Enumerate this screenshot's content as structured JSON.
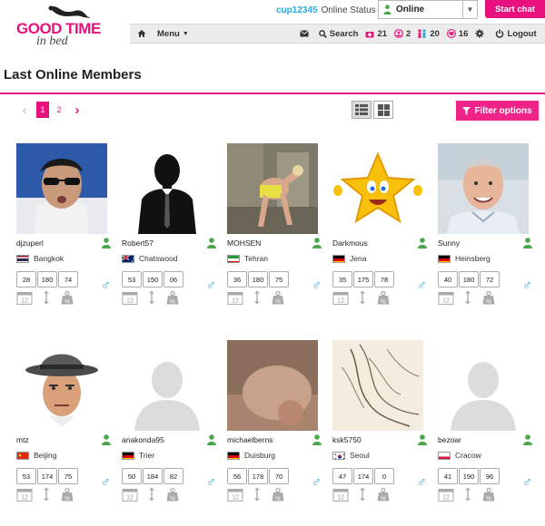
{
  "header": {
    "logo_top": "GOOD TIME",
    "logo_bottom": "in bed",
    "username": "cup12345",
    "status_label": "Online Status",
    "status_value": "Online",
    "start_chat": "Start chat"
  },
  "nav": {
    "menu": "Menu",
    "search": "Search",
    "photos_count": "21",
    "visitors_count": "2",
    "friends_count": "20",
    "favs_count": "16",
    "logout": "Logout"
  },
  "page": {
    "title": "Last Online Members",
    "pages": [
      "1",
      "2"
    ],
    "active_page": "1",
    "filter_label": "Filter options"
  },
  "colors": {
    "accent": "#e8117d",
    "online": "#49a84a",
    "male": "#2aa8d8"
  },
  "members": [
    {
      "name": "djzuperl",
      "city": "Bangkok",
      "flag": "th",
      "age": "28",
      "height": "180",
      "weight": "74",
      "photo": "sunglasses"
    },
    {
      "name": "Robert57",
      "city": "Chatswood",
      "flag": "au",
      "age": "53",
      "height": "150",
      "weight": "06",
      "photo": "silhouette"
    },
    {
      "name": "MOHSEN",
      "city": "Tehran",
      "flag": "ir",
      "age": "36",
      "height": "180",
      "weight": "75",
      "photo": "photo"
    },
    {
      "name": "Darkmous",
      "city": "Jena",
      "flag": "de",
      "age": "35",
      "height": "175",
      "weight": "78",
      "photo": "star"
    },
    {
      "name": "Sunny",
      "city": "Heinsberg",
      "flag": "de",
      "age": "40",
      "height": "180",
      "weight": "72",
      "photo": "man"
    },
    {
      "name": "mtz",
      "city": "Beijing",
      "flag": "cn",
      "age": "53",
      "height": "174",
      "weight": "75",
      "photo": "hat"
    },
    {
      "name": "anakonda95",
      "city": "Trier",
      "flag": "de",
      "age": "50",
      "height": "184",
      "weight": "82",
      "photo": "placeholder"
    },
    {
      "name": "michaelberns",
      "city": "Duisburg",
      "flag": "de",
      "age": "56",
      "height": "178",
      "weight": "70",
      "photo": "skin"
    },
    {
      "name": "ksk5750",
      "city": "Seoul",
      "flag": "kr",
      "age": "47",
      "height": "174",
      "weight": "0",
      "photo": "sketch"
    },
    {
      "name": "bezoar",
      "city": "Cracow",
      "flag": "pl",
      "age": "41",
      "height": "190",
      "weight": "96",
      "photo": "placeholder"
    }
  ]
}
